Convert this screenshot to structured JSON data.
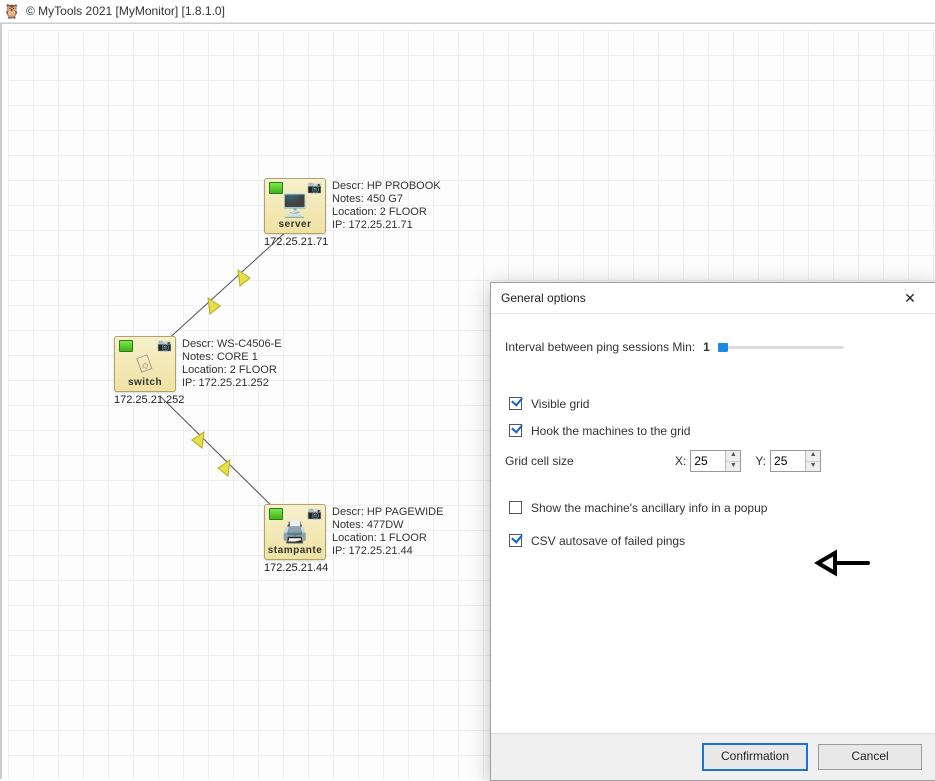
{
  "app": {
    "icon": "🦉",
    "title": "© MyTools 2021 [MyMonitor] [1.8.1.0]"
  },
  "nodes": {
    "server": {
      "type_label": "server",
      "glyph": "🖥️",
      "ip_caption": "172.25.21.71",
      "descr_label": "Descr:",
      "descr": "HP PROBOOK",
      "notes_label": "Notes:",
      "notes": "450 G7",
      "location_label": "Location:",
      "location": "2 FLOOR",
      "ip_label": "IP:",
      "ip": "172.25.21.71"
    },
    "switch": {
      "type_label": "switch",
      "glyph": "⌺",
      "ip_caption": "172.25.21.252",
      "descr_label": "Descr:",
      "descr": "WS-C4506-E",
      "notes_label": "Notes:",
      "notes": "CORE 1",
      "location_label": "Location:",
      "location": "2 FLOOR",
      "ip_label": "IP:",
      "ip": "172.25.21.252"
    },
    "printer": {
      "type_label": "stampante",
      "glyph": "🖨️",
      "ip_caption": "172.25.21.44",
      "descr_label": "Descr:",
      "descr": "HP PAGEWIDE",
      "notes_label": "Notes:",
      "notes": "477DW",
      "location_label": "Location:",
      "location": "1 FLOOR",
      "ip_label": "IP:",
      "ip": "172.25.21.44"
    }
  },
  "dialog": {
    "title": "General options",
    "close": "✕",
    "interval_label": "Interval between ping sessions  Min:",
    "interval_value": "1",
    "visible_grid_label": "Visible grid",
    "visible_grid_checked": true,
    "hook_label": "Hook the machines to the grid",
    "hook_checked": true,
    "gridsize_label": "Grid cell size",
    "x_label": "X:",
    "x_value": "25",
    "y_label": "Y:",
    "y_value": "25",
    "popup_label": "Show the machine's ancillary info in a popup",
    "popup_checked": false,
    "csv_label": "CSV autosave of failed pings",
    "csv_checked": true,
    "confirm_label": "Confirmation",
    "cancel_label": "Cancel"
  }
}
